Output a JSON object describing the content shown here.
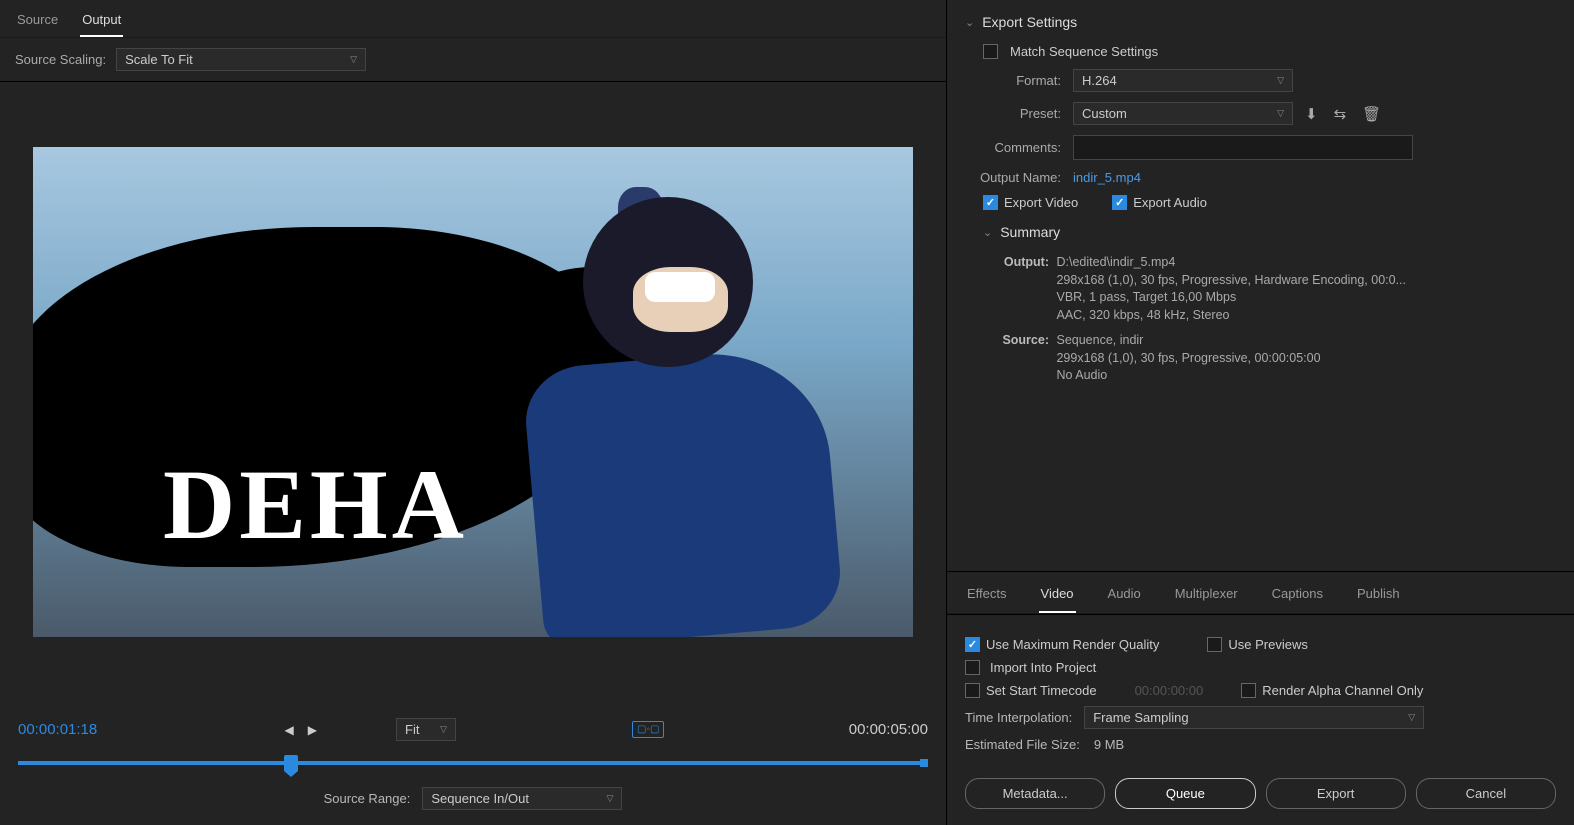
{
  "tabs": {
    "source": "Source",
    "output": "Output"
  },
  "scaling": {
    "label": "Source Scaling:",
    "value": "Scale To Fit"
  },
  "preview": {
    "text": "DEHA"
  },
  "timeline": {
    "current": "00:00:01:18",
    "end": "00:00:05:00",
    "fit": "Fit",
    "rangeLabel": "Source Range:",
    "rangeValue": "Sequence In/Out"
  },
  "export": {
    "title": "Export Settings",
    "matchSequence": "Match Sequence Settings",
    "formatLabel": "Format:",
    "formatValue": "H.264",
    "presetLabel": "Preset:",
    "presetValue": "Custom",
    "commentsLabel": "Comments:",
    "commentsValue": "",
    "outputNameLabel": "Output Name:",
    "outputNameValue": "indir_5.mp4",
    "exportVideo": "Export Video",
    "exportAudio": "Export Audio",
    "summary": {
      "title": "Summary",
      "outputLabel": "Output:",
      "outputPath": "D:\\edited\\indir_5.mp4",
      "outputLine2": "298x168 (1,0), 30 fps, Progressive, Hardware Encoding, 00:0...",
      "outputLine3": "VBR, 1 pass, Target 16,00 Mbps",
      "outputLine4": "AAC, 320 kbps, 48 kHz, Stereo",
      "sourceLabel": "Source:",
      "sourceLine1": "Sequence, indir",
      "sourceLine2": "299x168 (1,0), 30 fps, Progressive, 00:00:05:00",
      "sourceLine3": "No Audio"
    }
  },
  "subtabs": {
    "effects": "Effects",
    "video": "Video",
    "audio": "Audio",
    "multiplexer": "Multiplexer",
    "captions": "Captions",
    "publish": "Publish"
  },
  "footer": {
    "maxRender": "Use Maximum Render Quality",
    "usePreviews": "Use Previews",
    "importProject": "Import Into Project",
    "setStartTC": "Set Start Timecode",
    "startTC": "00:00:00:00",
    "renderAlpha": "Render Alpha Channel Only",
    "timeInterpLabel": "Time Interpolation:",
    "timeInterpValue": "Frame Sampling",
    "estLabel": "Estimated File Size:",
    "estValue": "9 MB"
  },
  "buttons": {
    "metadata": "Metadata...",
    "queue": "Queue",
    "export": "Export",
    "cancel": "Cancel"
  }
}
